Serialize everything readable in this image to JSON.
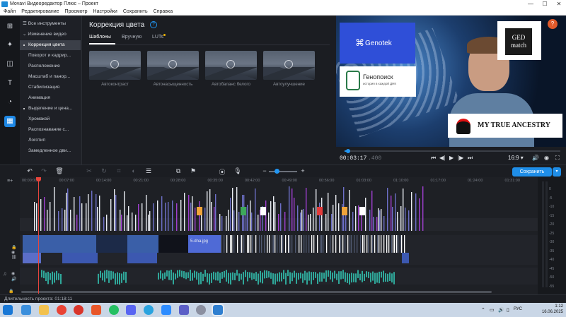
{
  "window": {
    "title": "Movavi Видеоредактор Плюс – Проект",
    "minimize": "—",
    "maximize": "☐",
    "close": "✕"
  },
  "menu": [
    "Файл",
    "Редактирование",
    "Просмотр",
    "Настройки",
    "Сохранить",
    "Справка"
  ],
  "leftnav": [
    "import-icon",
    "magic-wand-icon",
    "transitions-icon",
    "titles-icon",
    "filters-icon",
    "more-tools-icon"
  ],
  "sidebar": {
    "all_tools": "Все инструменты",
    "group_video": "Изменение видео",
    "items": [
      "Коррекция цвета",
      "Поворот и кадрир...",
      "Расположение",
      "Масштаб и панор...",
      "Стабилизация",
      "Анимация",
      "Выделение и цена...",
      "Хромакей",
      "Распознавание с...",
      "Логотип",
      "Замедленное дви..."
    ]
  },
  "panel": {
    "title": "Коррекция цвета",
    "help": "?",
    "tabs": [
      "Шаблоны",
      "Вручную",
      "LUTs"
    ],
    "active_tab": "Шаблоны",
    "presets": [
      "Автоконтраст",
      "Автонасыщенность",
      "Автобаланс белого",
      "Автоулучшение"
    ]
  },
  "preview": {
    "logos": {
      "genotek": "Genotek",
      "genotek_symbol": "⌘",
      "ged": "GED\nmatch",
      "genopoisk": "Генопоиск",
      "genopoisk_sub": "история в каждой ДНК",
      "mta": "MY TRUE ANCESTRY"
    },
    "help_badge": "?",
    "timecode_current": "00:03:17",
    "timecode_total": ".400",
    "aspect": "16:9 ▾",
    "progress": 0.015
  },
  "toolbar": {
    "save_label": "Сохранить",
    "save_dropdown": "▾"
  },
  "timeline": {
    "ruler": [
      "00:00:00",
      "00:07:00",
      "00:14:00",
      "00:21:00",
      "00:28:00",
      "00:35:00",
      "00:42:00",
      "00:49:00",
      "00:56:00",
      "01:03:00",
      "01:10:00",
      "01:17:00",
      "01:24:00",
      "01:31:00"
    ],
    "clip_label": "5-dna.jpg",
    "meter_labels": [
      "0",
      "-5",
      "-10",
      "-15",
      "-20",
      "-25",
      "-30",
      "-35",
      "-40",
      "-45",
      "-50",
      "-55"
    ]
  },
  "status": {
    "duration_label": "Длительность проекта: 01:18:11"
  },
  "taskbar": {
    "lang": "РУС",
    "time": "1:12",
    "date": "16.06.2025"
  }
}
